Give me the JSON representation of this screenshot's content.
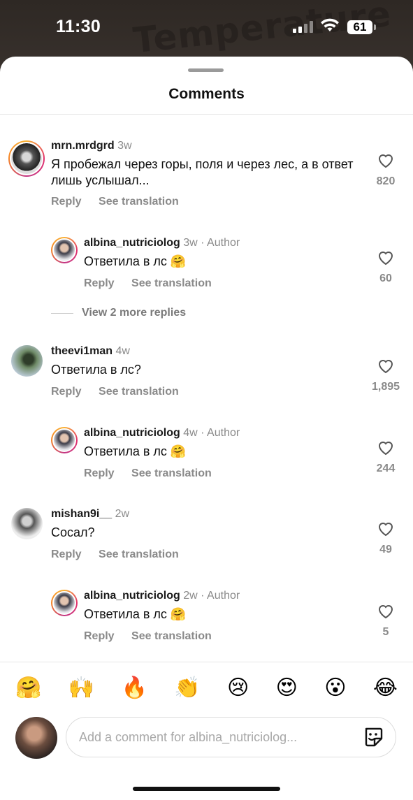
{
  "status": {
    "time": "11:30",
    "battery": "61"
  },
  "background_text": "Temperature",
  "sheet": {
    "title": "Comments"
  },
  "comments": [
    {
      "username": "mrn.mrdgrd",
      "time": "3w",
      "text": "Я пробежал через горы, поля и через лес, а в ответ лишь услышал...",
      "reply": "Reply",
      "translate": "See translation",
      "likes": "820",
      "reply_item": {
        "username": "albina_nutriciolog",
        "time": "3w",
        "author": "Author",
        "text": "Ответила в лс 🤗",
        "reply": "Reply",
        "translate": "See translation",
        "likes": "60"
      },
      "view_more": "View 2 more replies"
    },
    {
      "username": "theevi1man",
      "time": "4w",
      "text": "Ответила в лс?",
      "reply": "Reply",
      "translate": "See translation",
      "likes": "1,895",
      "reply_item": {
        "username": "albina_nutriciolog",
        "time": "4w",
        "author": "Author",
        "text": "Ответила в лс 🤗",
        "reply": "Reply",
        "translate": "See translation",
        "likes": "244"
      }
    },
    {
      "username": "mishan9i__",
      "time": "2w",
      "text": "Сосал?",
      "reply": "Reply",
      "translate": "See translation",
      "likes": "49",
      "reply_item": {
        "username": "albina_nutriciolog",
        "time": "2w",
        "author": "Author",
        "text": "Ответила в лс 🤗",
        "reply": "Reply",
        "translate": "See translation",
        "likes": "5"
      }
    }
  ],
  "emojis": [
    "🤗",
    "🙌",
    "🔥",
    "👏",
    "😢",
    "😍",
    "😮",
    "😂"
  ],
  "composer": {
    "placeholder": "Add a comment for albina_nutriciolog..."
  }
}
